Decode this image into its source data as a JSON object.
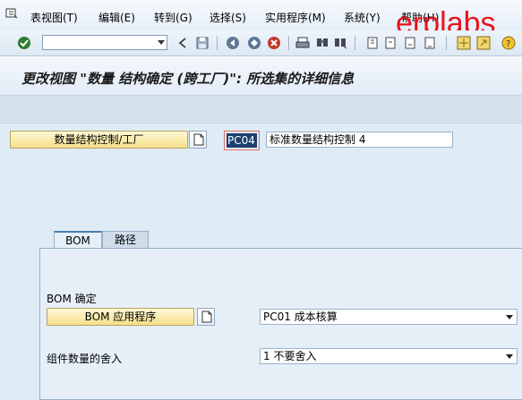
{
  "menu": {
    "items": [
      {
        "label": "表视图(T)"
      },
      {
        "label": "编辑(E)"
      },
      {
        "label": "转到(G)"
      },
      {
        "label": "选择(S)"
      },
      {
        "label": "实用程序(M)"
      },
      {
        "label": "系统(Y)"
      },
      {
        "label": "帮助(H)"
      }
    ],
    "watermark": "erplabs"
  },
  "toolbar": {
    "command_value": "",
    "icons": [
      "check-icon",
      "back-nav-icon",
      "save-icon",
      "back-icon",
      "exit-icon",
      "cancel-icon",
      "print-icon",
      "find-icon",
      "find-next-icon",
      "first-page-icon",
      "prev-page-icon",
      "next-page-icon",
      "last-page-icon",
      "new-session-icon",
      "shortcut-icon",
      "help-icon"
    ]
  },
  "title": "更改视图 \"数量 结构确定 (跨工厂)\": 所选集的详细信息",
  "header": {
    "key_button_label": "数量结构控制/工厂",
    "key_value": "PC04",
    "key_description": "标准数量结构控制 4"
  },
  "tabs": [
    {
      "label": "BOM",
      "active": true
    },
    {
      "label": "路径",
      "active": false
    }
  ],
  "bom": {
    "section_label": "BOM 确定",
    "app_button_label": "BOM 应用程序",
    "app_value": "PC01 成本核算",
    "rounding_label": "组件数量的舍入",
    "rounding_value": "1 不要舍入"
  },
  "colors": {
    "accent": "#1c3f70",
    "watermark": "#e8141c",
    "button_yellow": "#f7e08a"
  }
}
